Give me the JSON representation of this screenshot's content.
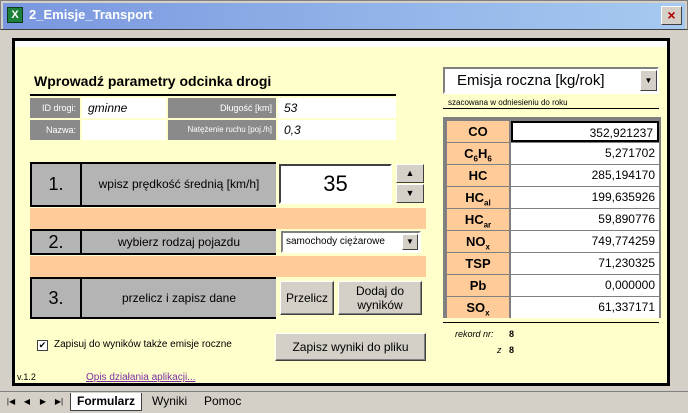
{
  "window": {
    "title": "2_Emisje_Transport",
    "app_icon": "X",
    "close": "×"
  },
  "form": {
    "heading": "Wprowadź parametry odcinka drogi",
    "info": {
      "id_label": "ID drogi:",
      "id_value": "gminne",
      "length_label": "Długość [km]",
      "length_value": "53",
      "name_label": "Nazwa:",
      "name_value": "",
      "traffic_label": "Natężenie ruchu [poj./h]",
      "traffic_value": "0,3"
    },
    "step1": {
      "num": "1.",
      "label": "wpisz prędkość średnią [km/h]",
      "speed": "35",
      "up": "▲",
      "down": "▼"
    },
    "step2": {
      "num": "2.",
      "label": "wybierz rodzaj pojazdu",
      "vehicle": "samochody ciężarowe",
      "arrow": "▼"
    },
    "step3": {
      "num": "3.",
      "label": "przelicz i zapisz dane",
      "calc_button": "Przelicz",
      "add_button": "Dodaj do wyników"
    },
    "checkbox_label": "Zapisuj do wyników także emisje roczne",
    "checkbox_mark": "✔",
    "save_button": "Zapisz wyniki do pliku",
    "version": "v.1.2",
    "help_link": "Opis działania aplikacji..."
  },
  "emission": {
    "title": "Emisja roczna [kg/rok]",
    "arrow": "▼",
    "subtitle": "szacowana w odniesieniu do roku",
    "rows": [
      {
        "name": "CO",
        "sub": "",
        "value": "352,921237"
      },
      {
        "name": "C",
        "sub": "6",
        "name2": "H",
        "sub2": "6",
        "value": "5,271702"
      },
      {
        "name": "HC",
        "sub": "",
        "value": "285,194170"
      },
      {
        "name": "HC",
        "sub": "al",
        "value": "199,635926"
      },
      {
        "name": "HC",
        "sub": "ar",
        "value": "59,890776"
      },
      {
        "name": "NO",
        "sub": "x",
        "value": "749,774259"
      },
      {
        "name": "TSP",
        "sub": "",
        "value": "71,230325"
      },
      {
        "name": "Pb",
        "sub": "",
        "value": "0,000000"
      },
      {
        "name": "SO",
        "sub": "x",
        "value": "61,337171"
      }
    ],
    "record_label": "rekord nr:",
    "record_value": "8",
    "of_label": "z",
    "of_value": "8"
  },
  "tabs": {
    "nav": [
      "|◀",
      "◀",
      "▶",
      "▶|"
    ],
    "sheets": [
      "Formularz",
      "Wyniki",
      "Pomoc"
    ]
  }
}
